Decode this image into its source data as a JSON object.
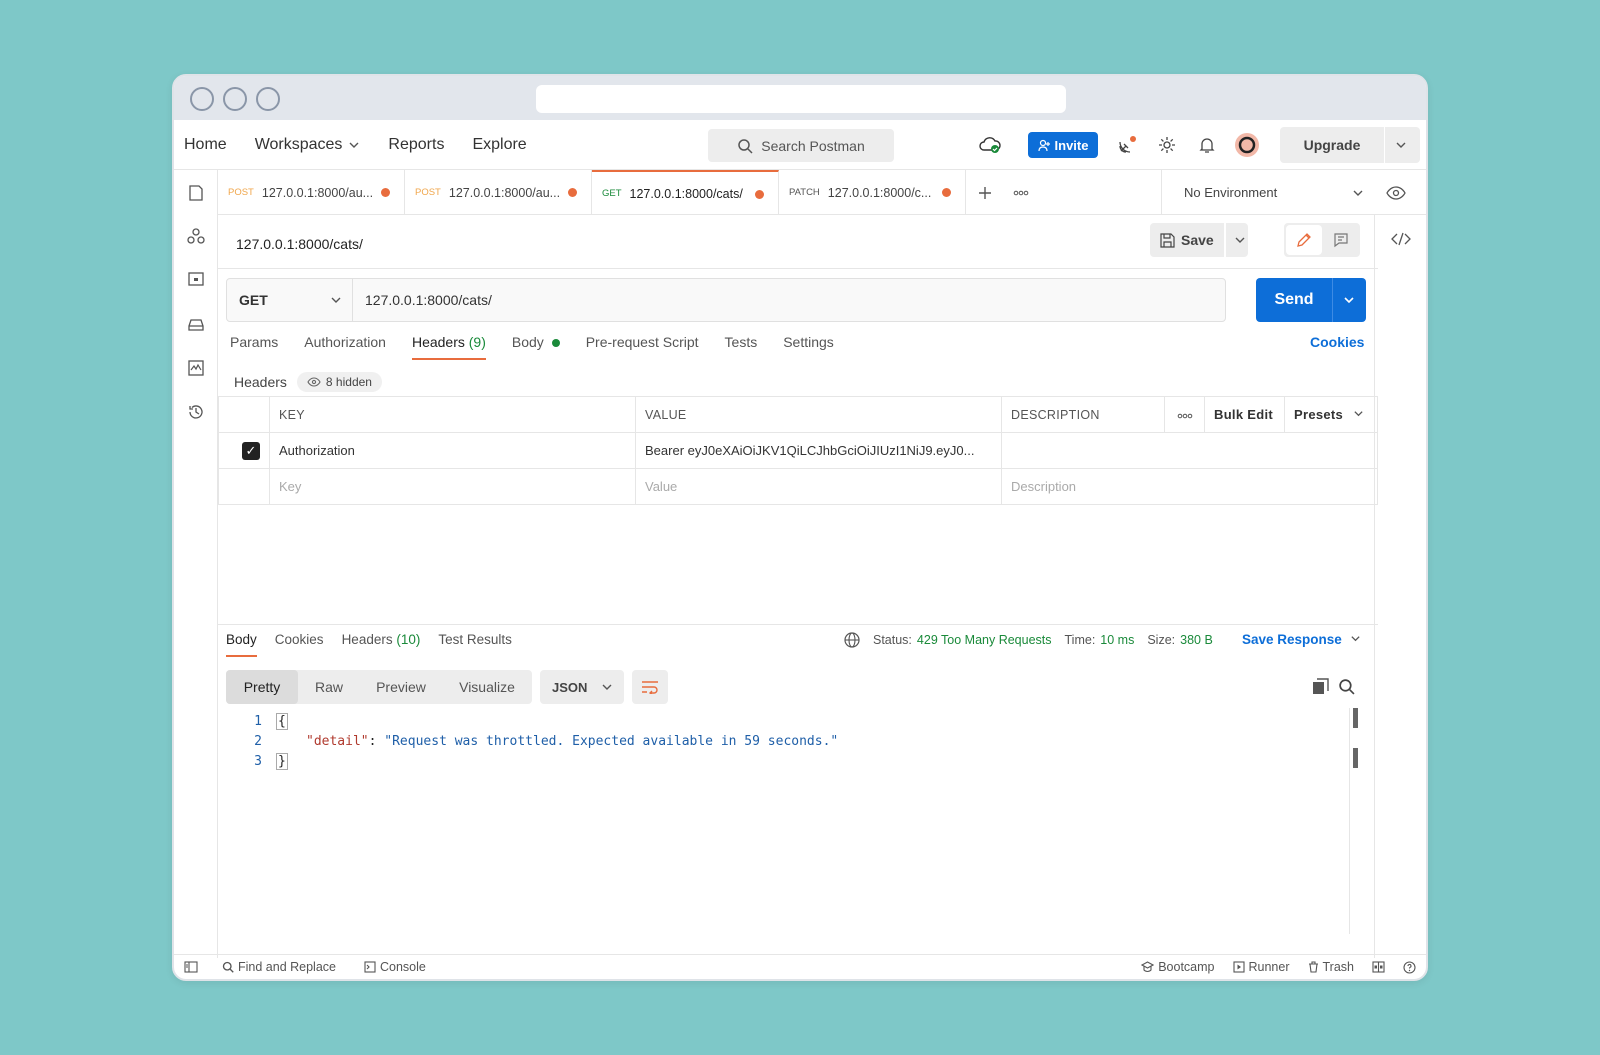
{
  "nav": {
    "home": "Home",
    "workspaces": "Workspaces",
    "reports": "Reports",
    "explore": "Explore",
    "search_placeholder": "Search Postman",
    "invite": "Invite",
    "upgrade": "Upgrade"
  },
  "tabs": [
    {
      "method": "POST",
      "url": "127.0.0.1:8000/au...",
      "method_color": "#f0a64b"
    },
    {
      "method": "POST",
      "url": "127.0.0.1:8000/au...",
      "method_color": "#f0a64b"
    },
    {
      "method": "GET",
      "url": "127.0.0.1:8000/cats/",
      "method_color": "#1a8a3a"
    },
    {
      "method": "PATCH",
      "url": "127.0.0.1:8000/c...",
      "method_color": "#555555"
    }
  ],
  "environment": "No Environment",
  "request": {
    "title": "127.0.0.1:8000/cats/",
    "save": "Save",
    "method": "GET",
    "url": "127.0.0.1:8000/cats/",
    "send": "Send"
  },
  "req_tabs": {
    "params": "Params",
    "authorization": "Authorization",
    "headers": "Headers",
    "headers_count": "(9)",
    "body": "Body",
    "prerequest": "Pre-request Script",
    "tests": "Tests",
    "settings": "Settings",
    "cookies": "Cookies"
  },
  "headers_section": {
    "label": "Headers",
    "hidden": "8 hidden",
    "col_key": "KEY",
    "col_value": "VALUE",
    "col_description": "DESCRIPTION",
    "bulk_edit": "Bulk Edit",
    "presets": "Presets",
    "row_key": "Authorization",
    "row_value": "Bearer eyJ0eXAiOiJKV1QiLCJhbGciOiJIUzI1NiJ9.eyJ0...",
    "ph_key": "Key",
    "ph_value": "Value",
    "ph_description": "Description"
  },
  "response": {
    "tab_body": "Body",
    "tab_cookies": "Cookies",
    "tab_headers": "Headers",
    "headers_count": "(10)",
    "tab_tests": "Test Results",
    "status_label": "Status:",
    "status_value": "429 Too Many Requests",
    "time_label": "Time:",
    "time_value": "10 ms",
    "size_label": "Size:",
    "size_value": "380 B",
    "save_response": "Save Response",
    "view_pretty": "Pretty",
    "view_raw": "Raw",
    "view_preview": "Preview",
    "view_visualize": "Visualize",
    "format": "JSON",
    "line1": "1",
    "line2": "2",
    "line3": "3",
    "open_brace": "{",
    "close_brace": "}",
    "json_key": "\"detail\"",
    "json_colon": ": ",
    "json_value": "\"Request was throttled. Expected available in 59 seconds.\""
  },
  "footer": {
    "find_replace": "Find and Replace",
    "console": "Console",
    "bootcamp": "Bootcamp",
    "runner": "Runner",
    "trash": "Trash"
  }
}
